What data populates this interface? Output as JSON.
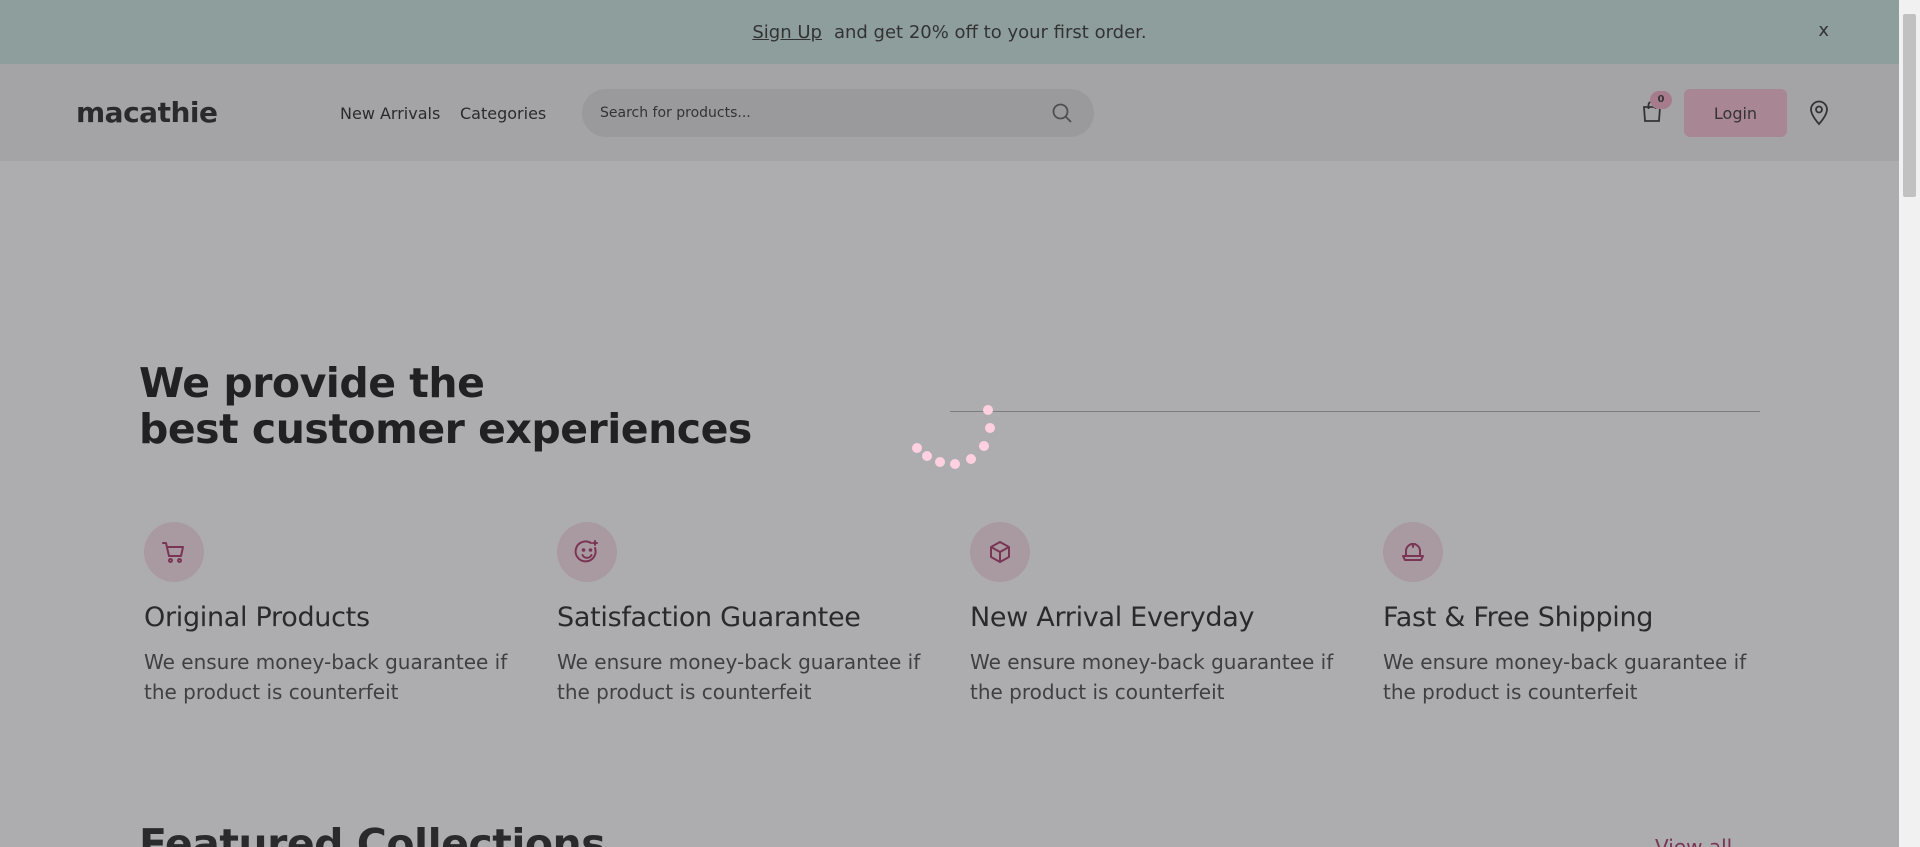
{
  "promo": {
    "link_label": "Sign Up",
    "message": "and get 20% off to your first order.",
    "close_label": "x"
  },
  "header": {
    "logo": "macathie",
    "nav": [
      {
        "label": "New Arrivals"
      },
      {
        "label": "Categories"
      }
    ],
    "search": {
      "placeholder": "Search for products...",
      "value": ""
    },
    "cart_count": "0",
    "login_label": "Login"
  },
  "hero": {
    "title_line1": "We provide the",
    "title_line2": "best customer experiences"
  },
  "features": [
    {
      "icon": "cart-icon",
      "title": "Original Products",
      "description": "We ensure money-back guarantee if the product is counterfeit"
    },
    {
      "icon": "smile-icon",
      "title": "Satisfaction Guarantee",
      "description": "We ensure money-back guarantee if the product is counterfeit"
    },
    {
      "icon": "box-icon",
      "title": "New Arrival Everyday",
      "description": "We ensure money-back guarantee if the product is counterfeit"
    },
    {
      "icon": "shipping-icon",
      "title": "Fast & Free Shipping",
      "description": "We ensure money-back guarantee if the product is counterfeit"
    }
  ],
  "featured": {
    "title": "Featured Collections",
    "view_all_label": "View all"
  },
  "colors": {
    "promo_bg": "#c6e4dc",
    "accent_pink": "#f8b9cd",
    "icon_bg": "#f8dde7",
    "icon_stroke": "#a3245a",
    "spinner": "#ffd0df"
  }
}
